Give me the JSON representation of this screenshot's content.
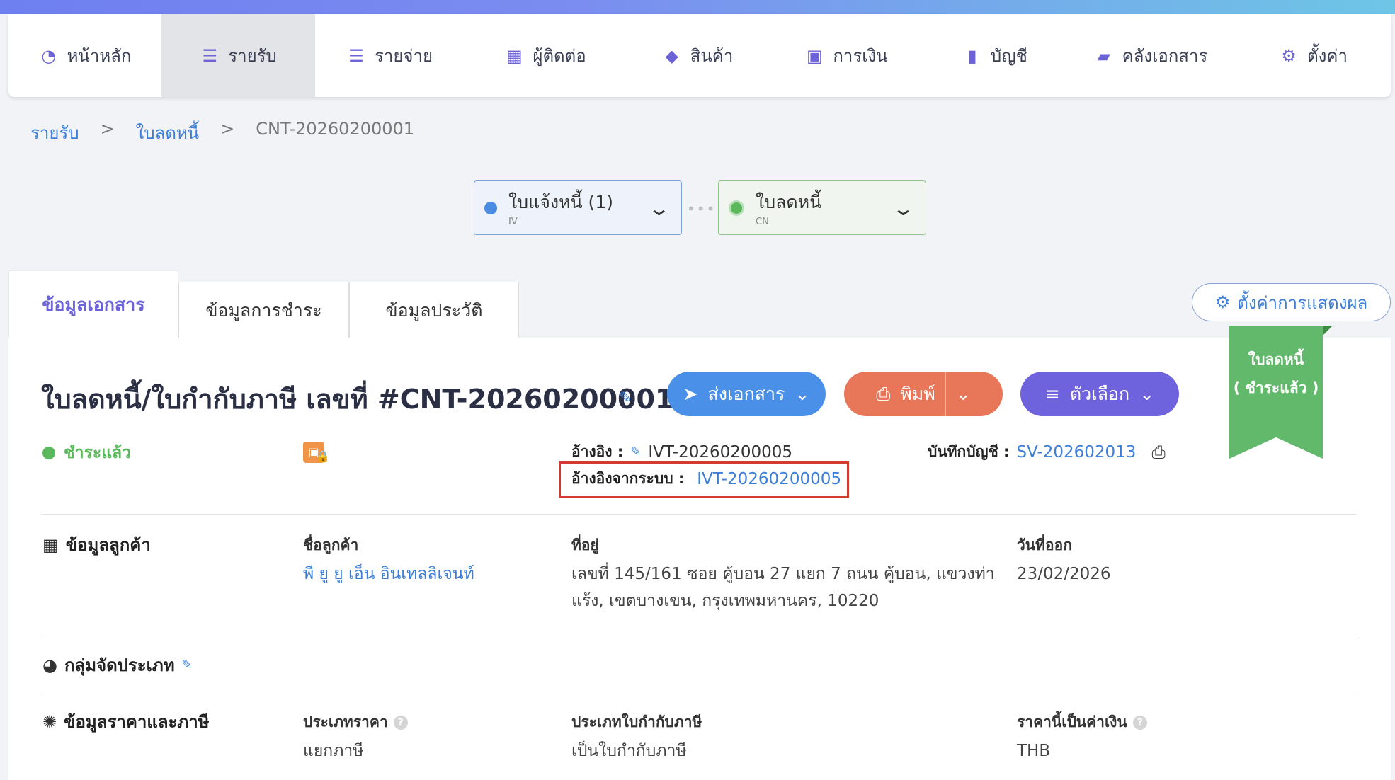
{
  "nav": {
    "items": [
      {
        "label": "หน้าหลัก",
        "icon": "dashboard-icon"
      },
      {
        "label": "รายรับ",
        "icon": "income-icon"
      },
      {
        "label": "รายจ่าย",
        "icon": "expense-icon"
      },
      {
        "label": "ผู้ติดต่อ",
        "icon": "contacts-icon"
      },
      {
        "label": "สินค้า",
        "icon": "product-box-icon"
      },
      {
        "label": "การเงิน",
        "icon": "money-icon"
      },
      {
        "label": "บัญชี",
        "icon": "accounting-book-icon"
      },
      {
        "label": "คลังเอกสาร",
        "icon": "folder-icon"
      },
      {
        "label": "ตั้งค่า",
        "icon": "gear-icon"
      }
    ],
    "active_index": 1
  },
  "breadcrumb": {
    "level1": "รายรับ",
    "level2": "ใบลดหนี้",
    "current": "CNT-20260200001",
    "sep": ">"
  },
  "flow": {
    "iv": {
      "title": "ใบแจ้งหนี้ (1)",
      "sub": "IV"
    },
    "cn": {
      "title": "ใบลดหนี้",
      "sub": "CN"
    }
  },
  "tabs": {
    "doc_info": "ข้อมูลเอกสาร",
    "payment_info": "ข้อมูลการชำระ",
    "history_info": "ข้อมูลประวัติ"
  },
  "display_settings_label": "ตั้งค่าการแสดงผล",
  "ribbon": {
    "line1": "ใบลดหนี้",
    "line2": "( ชำระแล้ว )"
  },
  "document": {
    "title": "ใบลดหนี้/ใบกำกับภาษี เลขที่ #CNT-20260200001",
    "status": "ชำระแล้ว",
    "reference_label": "อ้างอิง :",
    "reference_value": "IVT-20260200005",
    "system_reference_label": "อ้างอิงจากระบบ :",
    "system_reference_value": "IVT-20260200005",
    "account_record_label": "บันทึกบัญชี :",
    "account_record_value": "SV-202602013"
  },
  "actions": {
    "send": "ส่งเอกสาร",
    "print": "พิมพ์",
    "options": "ตัวเลือก"
  },
  "customer": {
    "section": "ข้อมูลลูกค้า",
    "name_label": "ชื่อลูกค้า",
    "name_value": "พี ยู ยู เอ็น อินเทลลิเจนท์",
    "address_label": "ที่อยู่",
    "address_line1": "เลขที่ 145/161 ซอย คู้บอน 27 แยก 7 ถนน คู้บอน, แขวงท่า",
    "address_line2": "แร้ง, เขตบางเขน, กรุงเทพมหานคร, 10220",
    "issue_date_label": "วันที่ออก",
    "issue_date_value": "23/02/2026"
  },
  "category": {
    "section": "กลุ่มจัดประเภท"
  },
  "pricing": {
    "section": "ข้อมูลราคาและภาษี",
    "price_type_label": "ประเภทราคา",
    "price_type_value": "แยกภาษี",
    "tax_invoice_type_label": "ประเภทใบกำกับภาษี",
    "tax_invoice_type_value": "เป็นใบกำกับภาษี",
    "currency_label": "ราคานี้เป็นค่าเงิน",
    "currency_value": "THB"
  },
  "colors": {
    "accent": "#6c63d9",
    "link": "#3c7ed8",
    "send_btn": "#4a90e8",
    "print_btn": "#e8775a",
    "options_btn": "#6f62dd",
    "paid_green": "#5cb85c",
    "highlight_red": "#d43a2f"
  }
}
